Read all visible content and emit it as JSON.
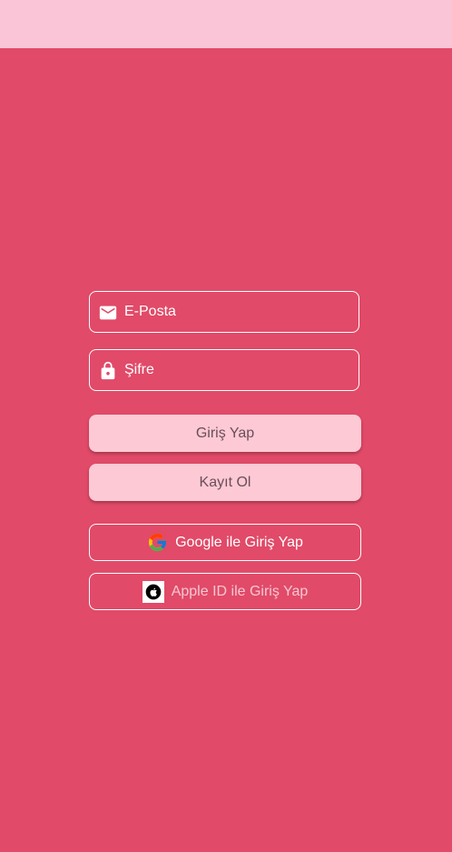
{
  "colors": {
    "background": "#e14a68",
    "app_bar": "#fac5d6",
    "button_fill": "#fcc9d5",
    "button_text": "#6b4e58",
    "outline": "#ffffff",
    "apple_label": "#f6c7d2"
  },
  "form": {
    "email": {
      "placeholder": "E-Posta",
      "value": "",
      "icon": "mail-icon"
    },
    "password": {
      "placeholder": "Şifre",
      "value": "",
      "icon": "lock-icon"
    },
    "login_label": "Giriş Yap",
    "register_label": "Kayıt Ol"
  },
  "social": {
    "google_label": "Google ile Giriş Yap",
    "google_icon": "google-logo-icon",
    "apple_label": "Apple ID ile Giriş Yap",
    "apple_icon": "apple-logo-icon"
  }
}
